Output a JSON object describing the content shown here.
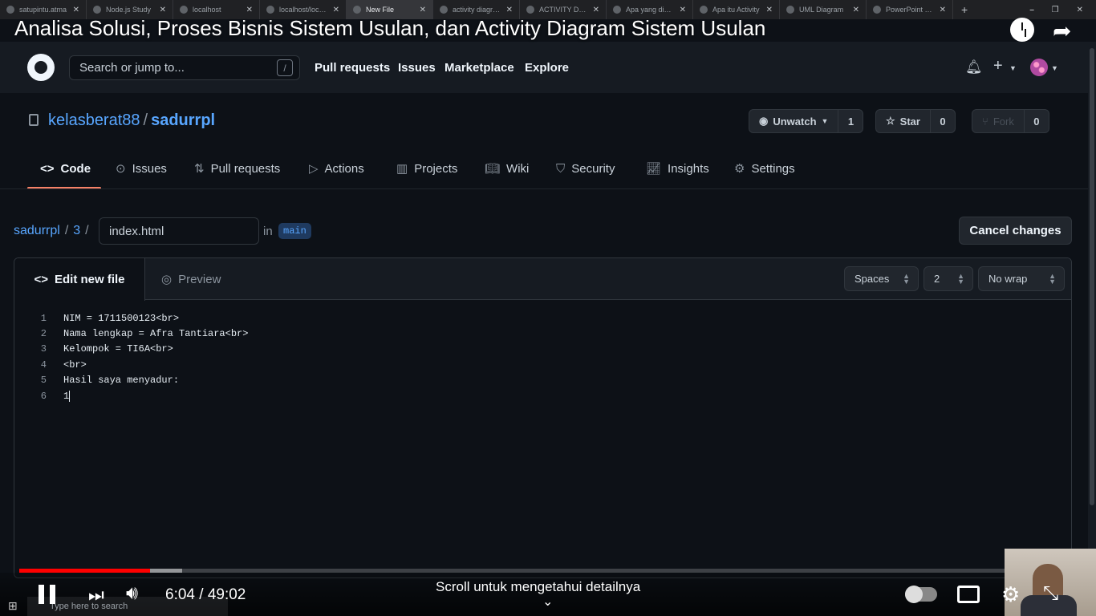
{
  "browser": {
    "tabs": [
      {
        "label": "satupintu.atma",
        "active": false
      },
      {
        "label": "Node.js Study",
        "active": false
      },
      {
        "label": "localhost",
        "active": false
      },
      {
        "label": "localhost/localh",
        "active": false
      },
      {
        "label": "New File",
        "active": true
      },
      {
        "label": "activity diagram",
        "active": false
      },
      {
        "label": "ACTIVITY DIAGR",
        "active": false
      },
      {
        "label": "Apa yang dimak",
        "active": false
      },
      {
        "label": "Apa itu Activity",
        "active": false
      },
      {
        "label": "UML Diagram",
        "active": false
      },
      {
        "label": "PowerPoint Pre",
        "active": false
      }
    ],
    "new_tab": "+",
    "window_controls": [
      "⎯",
      "❐",
      "✕"
    ]
  },
  "video": {
    "title": "Analisa Solusi, Proses Bisnis Sistem Usulan, dan Activity Diagram Sistem Usulan",
    "current_time": "6:04",
    "duration": "49:02",
    "progress": 0.1235,
    "buffered": 0.154,
    "scroll_hint": "Scroll untuk mengetahui detailnya",
    "share_icon": "share-icon",
    "watch_later_icon": "clock-icon"
  },
  "github": {
    "search_placeholder": "Search or jump to...",
    "search_shortcut": "/",
    "nav": [
      "Pull requests",
      "Issues",
      "Marketplace",
      "Explore"
    ],
    "repo": {
      "owner": "kelasberat88",
      "separator": "/",
      "name": "sadurrpl"
    },
    "buttons": {
      "watch_label": "Unwatch",
      "watch_count": "1",
      "star_label": "Star",
      "star_count": "0",
      "fork_label": "Fork",
      "fork_count": "0"
    },
    "repo_tabs": [
      {
        "label": "Code",
        "icon": "code-icon",
        "selected": true
      },
      {
        "label": "Issues",
        "icon": "issue-icon",
        "selected": false
      },
      {
        "label": "Pull requests",
        "icon": "pull-request-icon",
        "selected": false
      },
      {
        "label": "Actions",
        "icon": "play-icon",
        "selected": false
      },
      {
        "label": "Projects",
        "icon": "project-icon",
        "selected": false
      },
      {
        "label": "Wiki",
        "icon": "book-icon",
        "selected": false
      },
      {
        "label": "Security",
        "icon": "shield-icon",
        "selected": false
      },
      {
        "label": "Insights",
        "icon": "graph-icon",
        "selected": false
      },
      {
        "label": "Settings",
        "icon": "gear-icon",
        "selected": false
      }
    ],
    "breadcrumb": {
      "repo": "sadurrpl",
      "folder": "3",
      "sep": "/"
    },
    "filename": "index.html",
    "in_label": "in",
    "branch": "main",
    "cancel_label": "Cancel changes",
    "editor": {
      "edit_tab": "Edit new file",
      "preview_tab": "Preview",
      "indent_mode": "Spaces",
      "indent_size": "2",
      "wrap_mode": "No wrap",
      "lines": [
        {
          "n": "1",
          "text": "NIM = 1711500123<br>"
        },
        {
          "n": "2",
          "text": "Nama lengkap = Afra Tantiara<br>"
        },
        {
          "n": "3",
          "text": "Kelompok = TI6A<br>"
        },
        {
          "n": "4",
          "text": "<br>"
        },
        {
          "n": "5",
          "text": "Hasil saya menyadur:"
        },
        {
          "n": "6",
          "text": "1"
        }
      ]
    }
  },
  "taskbar": {
    "search_placeholder": "Type here to search"
  }
}
